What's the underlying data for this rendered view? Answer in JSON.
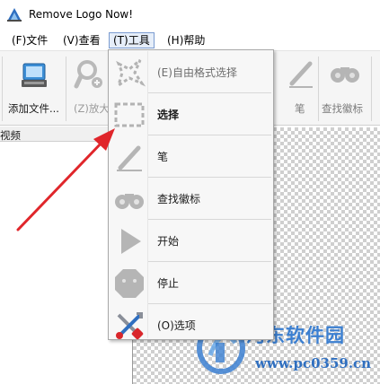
{
  "window": {
    "title": "Remove Logo Now!"
  },
  "menubar": {
    "items": [
      {
        "label": "(F)文件"
      },
      {
        "label": "(V)查看"
      },
      {
        "label": "(T)工具"
      },
      {
        "label": "(H)帮助"
      }
    ]
  },
  "toolbar": {
    "add_file": "添加文件...",
    "zoom": "(Z)放大",
    "pen": "笔",
    "find_logo": "查找徽标"
  },
  "left_panel": {
    "header": "视频"
  },
  "tools_menu": {
    "items": [
      {
        "label": "(E)自由格式选择",
        "icon": "freeform-select-icon",
        "disabled": true
      },
      {
        "label": "选择",
        "icon": "rect-select-icon",
        "bold": true
      },
      {
        "label": "笔",
        "icon": "pen-icon"
      },
      {
        "label": "查找徽标",
        "icon": "find-logo-icon"
      },
      {
        "label": "开始",
        "icon": "play-icon"
      },
      {
        "label": "停止",
        "icon": "stop-icon"
      },
      {
        "label": "(O)选项",
        "icon": "options-tools-icon"
      }
    ]
  },
  "watermark": {
    "text": "河东软件园",
    "url": "www.pc0359.cn"
  },
  "colors": {
    "accent_arrow": "#e0262b",
    "watermark_blue": "#3b7fd1",
    "menu_highlight": "#e6eef9"
  }
}
